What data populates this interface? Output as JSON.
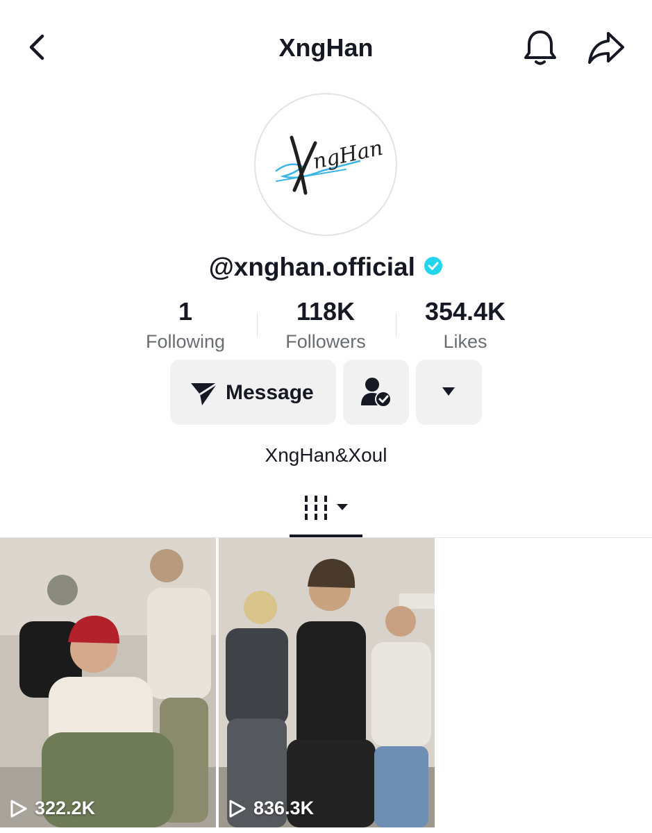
{
  "header": {
    "title": "XngHan"
  },
  "profile": {
    "avatar_text": "XngHan",
    "handle": "@xnghan.official",
    "verified_color": "#20d5ec"
  },
  "stats": [
    {
      "value": "1",
      "label": "Following"
    },
    {
      "value": "118K",
      "label": "Followers"
    },
    {
      "value": "354.4K",
      "label": "Likes"
    }
  ],
  "actions": {
    "message_label": "Message"
  },
  "bio": "XngHan&Xoul",
  "videos": [
    {
      "views": "322.2K"
    },
    {
      "views": "836.3K"
    }
  ],
  "icons": {
    "back": "chevron-left-icon",
    "bell": "bell-icon",
    "share": "share-arrow-icon",
    "message": "send-icon",
    "friend": "user-check-icon",
    "more": "caret-down-icon",
    "tab": "grid-icon",
    "play": "play-icon"
  }
}
